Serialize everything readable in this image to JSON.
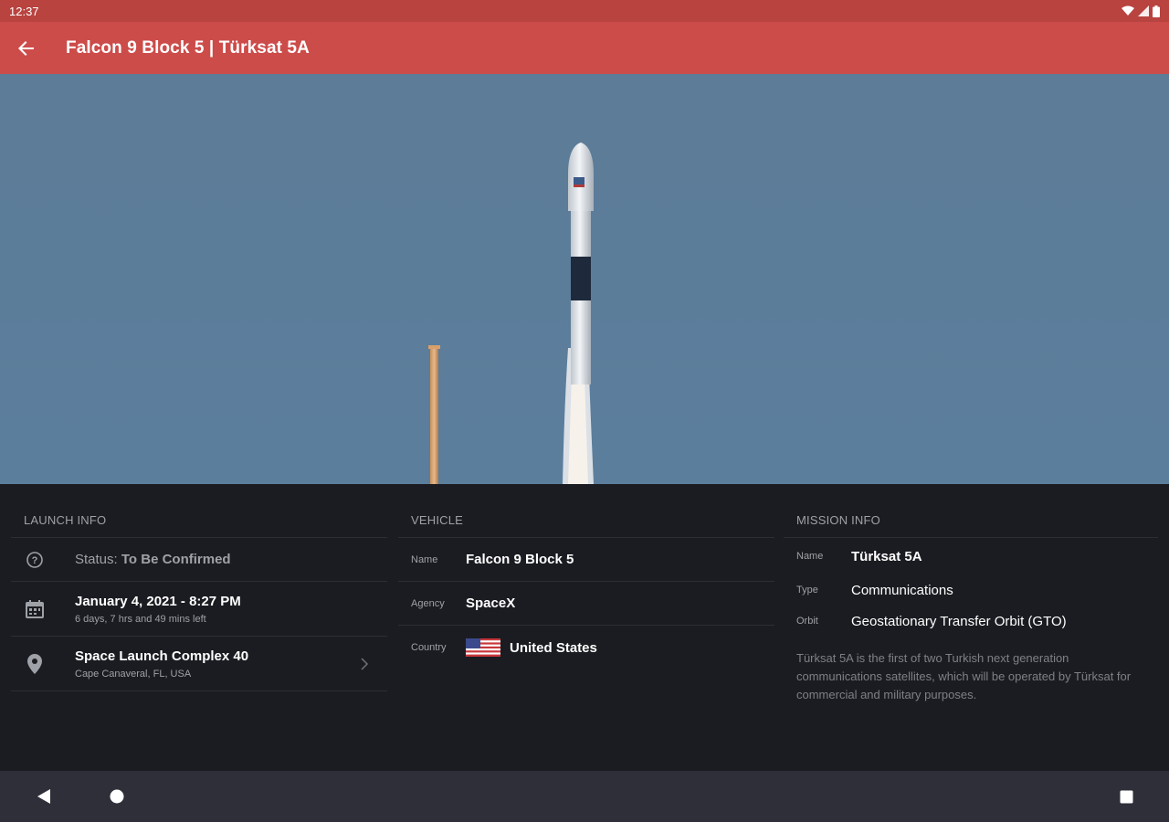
{
  "status_bar": {
    "time": "12:37"
  },
  "app_bar": {
    "title": "Falcon 9 Block 5 | Türksat 5A",
    "back_icon": "arrow-left-icon"
  },
  "launch_info": {
    "section_title": "LAUNCH INFO",
    "status_label": "Status:",
    "status_value": "To Be Confirmed",
    "date": "January 4, 2021 - 8:27 PM",
    "countdown": "6 days, 7 hrs and 49 mins left",
    "location_name": "Space Launch Complex 40",
    "location_sub": "Cape Canaveral, FL, USA"
  },
  "vehicle": {
    "section_title": "VEHICLE",
    "name_label": "Name",
    "name_value": "Falcon 9 Block 5",
    "agency_label": "Agency",
    "agency_value": "SpaceX",
    "country_label": "Country",
    "country_value": "United States"
  },
  "mission_info": {
    "section_title": "MISSION INFO",
    "name_label": "Name",
    "name_value": "Türksat 5A",
    "type_label": "Type",
    "type_value": "Communications",
    "orbit_label": "Orbit",
    "orbit_value": "Geostationary Transfer Orbit (GTO)",
    "description": "Türksat 5A is the first of two Turkish next generation communications satellites, which will be operated by Türksat for commercial and military purposes."
  },
  "colors": {
    "app_bar": "#cc4c4a",
    "status_bar": "#b8433f",
    "content_bg": "#1b1c21",
    "nav_bar": "#2e2f38"
  }
}
